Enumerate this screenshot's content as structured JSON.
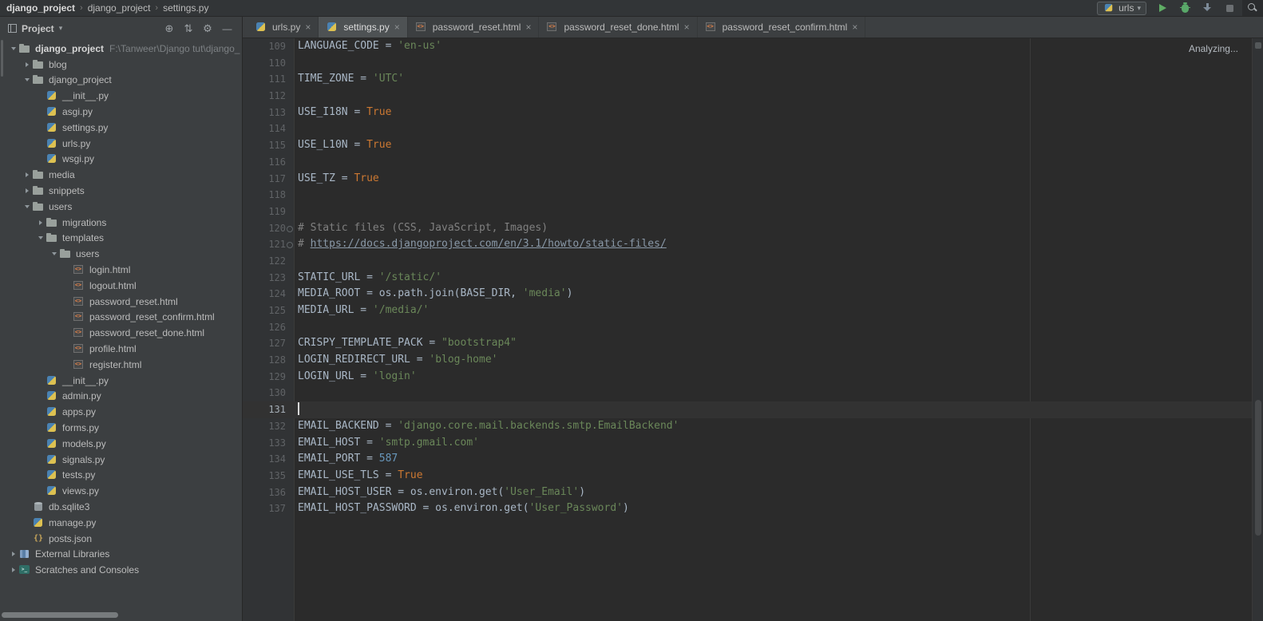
{
  "titlebar": {
    "breadcrumbs": [
      "django_project",
      "django_project",
      "settings.py"
    ],
    "separator": "›",
    "run_config": "urls",
    "icons": {
      "caret_down": "▾",
      "close": "×"
    }
  },
  "project_panel": {
    "title": "Project",
    "header_icons": {
      "locate": "⊕",
      "collapse": "⇅",
      "gear": "⚙",
      "hide": "—"
    },
    "tree": [
      {
        "depth": 0,
        "label": "django_project",
        "icon": "folder",
        "chevron": "open",
        "bold": true,
        "extra": "F:\\Tanweer\\Django tut\\django_p"
      },
      {
        "depth": 1,
        "label": "blog",
        "icon": "folder",
        "chevron": "closed"
      },
      {
        "depth": 1,
        "label": "django_project",
        "icon": "folder",
        "chevron": "open"
      },
      {
        "depth": 2,
        "label": "__init__.py",
        "icon": "py"
      },
      {
        "depth": 2,
        "label": "asgi.py",
        "icon": "py"
      },
      {
        "depth": 2,
        "label": "settings.py",
        "icon": "py"
      },
      {
        "depth": 2,
        "label": "urls.py",
        "icon": "py"
      },
      {
        "depth": 2,
        "label": "wsgi.py",
        "icon": "py"
      },
      {
        "depth": 1,
        "label": "media",
        "icon": "folder",
        "chevron": "closed"
      },
      {
        "depth": 1,
        "label": "snippets",
        "icon": "folder",
        "chevron": "closed"
      },
      {
        "depth": 1,
        "label": "users",
        "icon": "folder",
        "chevron": "open"
      },
      {
        "depth": 2,
        "label": "migrations",
        "icon": "folder",
        "chevron": "closed"
      },
      {
        "depth": 2,
        "label": "templates",
        "icon": "folder",
        "chevron": "open"
      },
      {
        "depth": 3,
        "label": "users",
        "icon": "folder",
        "chevron": "open"
      },
      {
        "depth": 4,
        "label": "login.html",
        "icon": "html"
      },
      {
        "depth": 4,
        "label": "logout.html",
        "icon": "html"
      },
      {
        "depth": 4,
        "label": "password_reset.html",
        "icon": "html"
      },
      {
        "depth": 4,
        "label": "password_reset_confirm.html",
        "icon": "html"
      },
      {
        "depth": 4,
        "label": "password_reset_done.html",
        "icon": "html"
      },
      {
        "depth": 4,
        "label": "profile.html",
        "icon": "html"
      },
      {
        "depth": 4,
        "label": "register.html",
        "icon": "html"
      },
      {
        "depth": 2,
        "label": "__init__.py",
        "icon": "py"
      },
      {
        "depth": 2,
        "label": "admin.py",
        "icon": "py"
      },
      {
        "depth": 2,
        "label": "apps.py",
        "icon": "py"
      },
      {
        "depth": 2,
        "label": "forms.py",
        "icon": "py"
      },
      {
        "depth": 2,
        "label": "models.py",
        "icon": "py"
      },
      {
        "depth": 2,
        "label": "signals.py",
        "icon": "py"
      },
      {
        "depth": 2,
        "label": "tests.py",
        "icon": "py"
      },
      {
        "depth": 2,
        "label": "views.py",
        "icon": "py"
      },
      {
        "depth": 1,
        "label": "db.sqlite3",
        "icon": "db"
      },
      {
        "depth": 1,
        "label": "manage.py",
        "icon": "py"
      },
      {
        "depth": 1,
        "label": "posts.json",
        "icon": "json"
      },
      {
        "depth": 0,
        "label": "External Libraries",
        "icon": "lib",
        "chevron": "closed"
      },
      {
        "depth": 0,
        "label": "Scratches and Consoles",
        "icon": "console",
        "chevron": "closed"
      }
    ]
  },
  "tabs": [
    {
      "label": "urls.py",
      "icon": "py",
      "active": false
    },
    {
      "label": "settings.py",
      "icon": "py",
      "active": true
    },
    {
      "label": "password_reset.html",
      "icon": "html",
      "active": false
    },
    {
      "label": "password_reset_done.html",
      "icon": "html",
      "active": false
    },
    {
      "label": "password_reset_confirm.html",
      "icon": "html",
      "active": false
    }
  ],
  "editor": {
    "status": "Analyzing...",
    "lines": [
      {
        "n": 109,
        "t": [
          [
            "p",
            "LANGUAGE_CODE = "
          ],
          [
            "s",
            "'en-us'"
          ]
        ]
      },
      {
        "n": 110,
        "t": []
      },
      {
        "n": 111,
        "t": [
          [
            "p",
            "TIME_ZONE = "
          ],
          [
            "s",
            "'UTC'"
          ]
        ]
      },
      {
        "n": 112,
        "t": []
      },
      {
        "n": 113,
        "t": [
          [
            "p",
            "USE_I18N = "
          ],
          [
            "k",
            "True"
          ]
        ]
      },
      {
        "n": 114,
        "t": []
      },
      {
        "n": 115,
        "t": [
          [
            "p",
            "USE_L10N = "
          ],
          [
            "k",
            "True"
          ]
        ]
      },
      {
        "n": 116,
        "t": []
      },
      {
        "n": 117,
        "t": [
          [
            "p",
            "USE_TZ = "
          ],
          [
            "k",
            "True"
          ]
        ]
      },
      {
        "n": 118,
        "t": []
      },
      {
        "n": 119,
        "t": []
      },
      {
        "n": 120,
        "t": [
          [
            "c",
            "# Static files (CSS, JavaScript, Images)"
          ]
        ],
        "mark": true
      },
      {
        "n": 121,
        "t": [
          [
            "c",
            "# "
          ],
          [
            "l",
            "https://docs.djangoproject.com/en/3.1/howto/static-files/"
          ]
        ],
        "mark": true
      },
      {
        "n": 122,
        "t": []
      },
      {
        "n": 123,
        "t": [
          [
            "p",
            "STATIC_URL = "
          ],
          [
            "s",
            "'/static/'"
          ]
        ]
      },
      {
        "n": 124,
        "t": [
          [
            "p",
            "MEDIA_ROOT = os.path.join(BASE_DIR, "
          ],
          [
            "s",
            "'media'"
          ],
          [
            "p",
            ")"
          ]
        ]
      },
      {
        "n": 125,
        "t": [
          [
            "p",
            "MEDIA_URL = "
          ],
          [
            "s",
            "'/media/'"
          ]
        ]
      },
      {
        "n": 126,
        "t": []
      },
      {
        "n": 127,
        "t": [
          [
            "p",
            "CRISPY_TEMPLATE_PACK = "
          ],
          [
            "s",
            "\"bootstrap4\""
          ]
        ]
      },
      {
        "n": 128,
        "t": [
          [
            "p",
            "LOGIN_REDIRECT_URL = "
          ],
          [
            "s",
            "'blog-home'"
          ]
        ]
      },
      {
        "n": 129,
        "t": [
          [
            "p",
            "LOGIN_URL = "
          ],
          [
            "s",
            "'login'"
          ]
        ]
      },
      {
        "n": 130,
        "t": []
      },
      {
        "n": 131,
        "t": [],
        "current": true
      },
      {
        "n": 132,
        "t": [
          [
            "p",
            "EMAIL_BACKEND = "
          ],
          [
            "s",
            "'django.core.mail.backends.smtp.EmailBackend'"
          ]
        ]
      },
      {
        "n": 133,
        "t": [
          [
            "p",
            "EMAIL_HOST = "
          ],
          [
            "s",
            "'smtp.gmail.com'"
          ]
        ]
      },
      {
        "n": 134,
        "t": [
          [
            "p",
            "EMAIL_PORT = "
          ],
          [
            "n",
            "587"
          ]
        ]
      },
      {
        "n": 135,
        "t": [
          [
            "p",
            "EMAIL_USE_TLS = "
          ],
          [
            "k",
            "True"
          ]
        ]
      },
      {
        "n": 136,
        "t": [
          [
            "p",
            "EMAIL_HOST_USER = os.environ.get("
          ],
          [
            "s",
            "'User_Email'"
          ],
          [
            "p",
            ")"
          ]
        ]
      },
      {
        "n": 137,
        "t": [
          [
            "p",
            "EMAIL_HOST_PASSWORD = os.environ.get("
          ],
          [
            "s",
            "'User_Password'"
          ],
          [
            "p",
            ")"
          ]
        ]
      }
    ]
  },
  "colors": {
    "panel_bg": "#3c3f41",
    "editor_bg": "#2b2b2b",
    "gutter_bg": "#313335",
    "string": "#6a8759",
    "keyword": "#cc7832",
    "number": "#6897bb",
    "comment": "#808080",
    "plain": "#a9b7c6",
    "line_number": "#606366",
    "current_line": "#323232",
    "run_green": "#59a869"
  }
}
